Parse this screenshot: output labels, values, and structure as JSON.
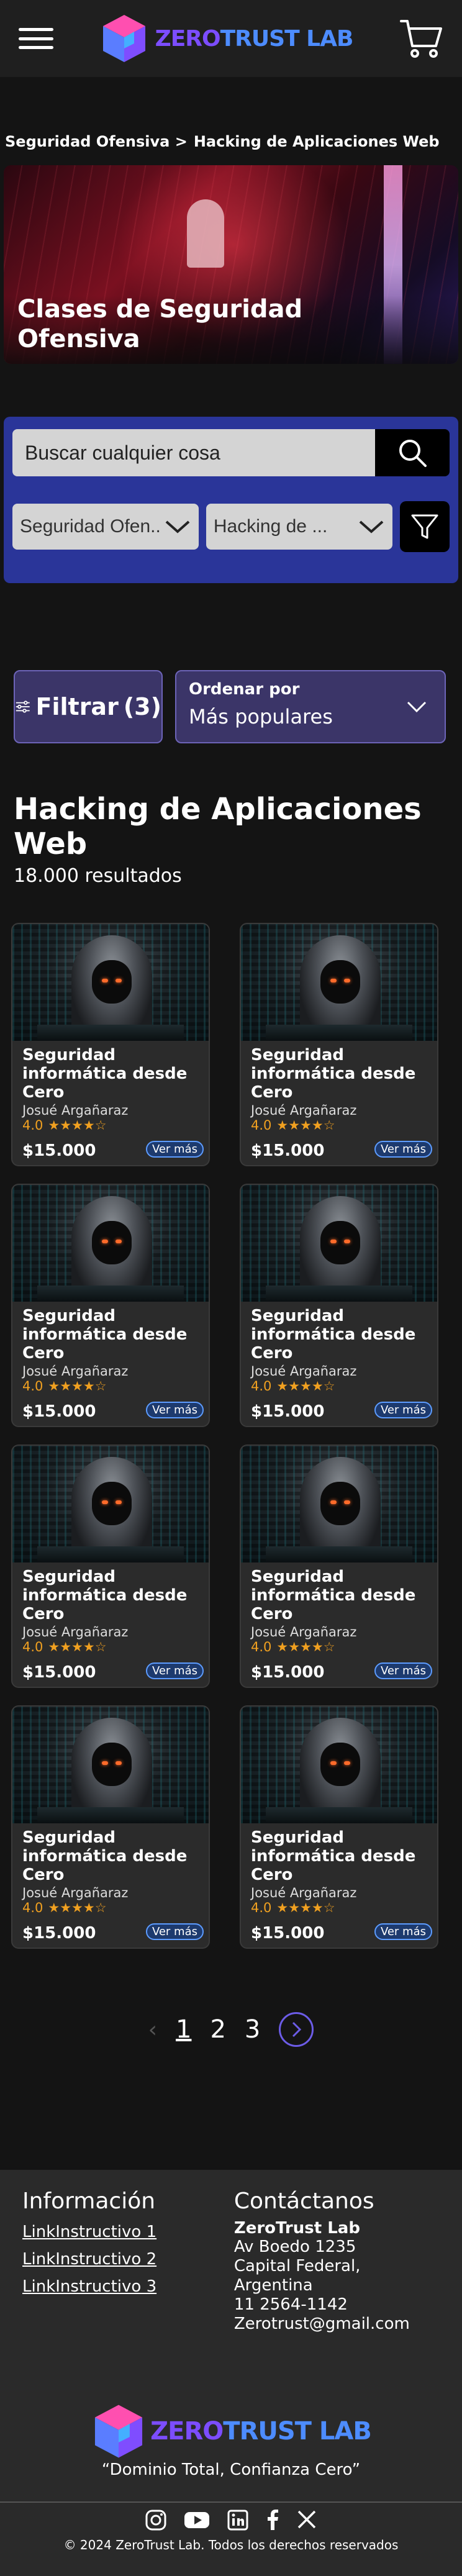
{
  "header": {
    "logo_text_a": "ZERO",
    "logo_text_b": "TRUST LAB"
  },
  "breadcrumb": {
    "items": [
      "Seguridad Ofensiva >",
      "Hacking de Aplicaciones Web"
    ]
  },
  "hero": {
    "title": "Clases de Seguridad Ofensiva"
  },
  "search": {
    "placeholder": "Buscar cualquier cosa",
    "category_selected": "Seguridad Ofen..",
    "subcategory_selected": "Hacking de ..."
  },
  "sort": {
    "filter_label": "Filtrar",
    "filter_count": "(3)",
    "order_label": "Ordenar por",
    "order_value": "Más populares"
  },
  "results": {
    "title": "Hacking de Aplicaciones Web",
    "count": "18.000 resultados"
  },
  "courses": [
    {
      "title": "Seguridad informática desde Cero",
      "author": "Josué Argañaraz",
      "rating": "4.0",
      "stars": "★★★★☆",
      "price": "$15.000",
      "more": "Ver más"
    },
    {
      "title": "Seguridad informática desde Cero",
      "author": "Josué Argañaraz",
      "rating": "4.0",
      "stars": "★★★★☆",
      "price": "$15.000",
      "more": "Ver más"
    },
    {
      "title": "Seguridad informática desde Cero",
      "author": "Josué Argañaraz",
      "rating": "4.0",
      "stars": "★★★★☆",
      "price": "$15.000",
      "more": "Ver más"
    },
    {
      "title": "Seguridad informática desde Cero",
      "author": "Josué Argañaraz",
      "rating": "4.0",
      "stars": "★★★★☆",
      "price": "$15.000",
      "more": "Ver más"
    },
    {
      "title": "Seguridad informática desde Cero",
      "author": "Josué Argañaraz",
      "rating": "4.0",
      "stars": "★★★★☆",
      "price": "$15.000",
      "more": "Ver más"
    },
    {
      "title": "Seguridad informática desde Cero",
      "author": "Josué Argañaraz",
      "rating": "4.0",
      "stars": "★★★★☆",
      "price": "$15.000",
      "more": "Ver más"
    },
    {
      "title": "Seguridad informática desde Cero",
      "author": "Josué Argañaraz",
      "rating": "4.0",
      "stars": "★★★★☆",
      "price": "$15.000",
      "more": "Ver más"
    },
    {
      "title": "Seguridad informática desde Cero",
      "author": "Josué Argañaraz",
      "rating": "4.0",
      "stars": "★★★★☆",
      "price": "$15.000",
      "more": "Ver más"
    }
  ],
  "pagination": {
    "pages": [
      "1",
      "2",
      "3"
    ],
    "current": "1",
    "prev_icon": "‹"
  },
  "footer": {
    "info_title": "Información",
    "links": [
      "LinkInstructivo 1",
      "LinkInstructivo 2",
      "LinkInstructivo 3"
    ],
    "contact_title": "Contáctanos",
    "contact_brand": "ZeroTrust Lab",
    "contact_lines": [
      "Av Boedo 1235",
      "Capital Federal, Argentina",
      "11 2564-1142",
      "Zerotrust@gmail.com"
    ],
    "slogan": "“Dominio Total, Confianza Cero”",
    "copyright": "© 2024 ZeroTrust Lab. Todos los derechos reservados",
    "socials": [
      "instagram-icon",
      "youtube-icon",
      "linkedin-icon",
      "facebook-icon",
      "x-icon"
    ]
  }
}
